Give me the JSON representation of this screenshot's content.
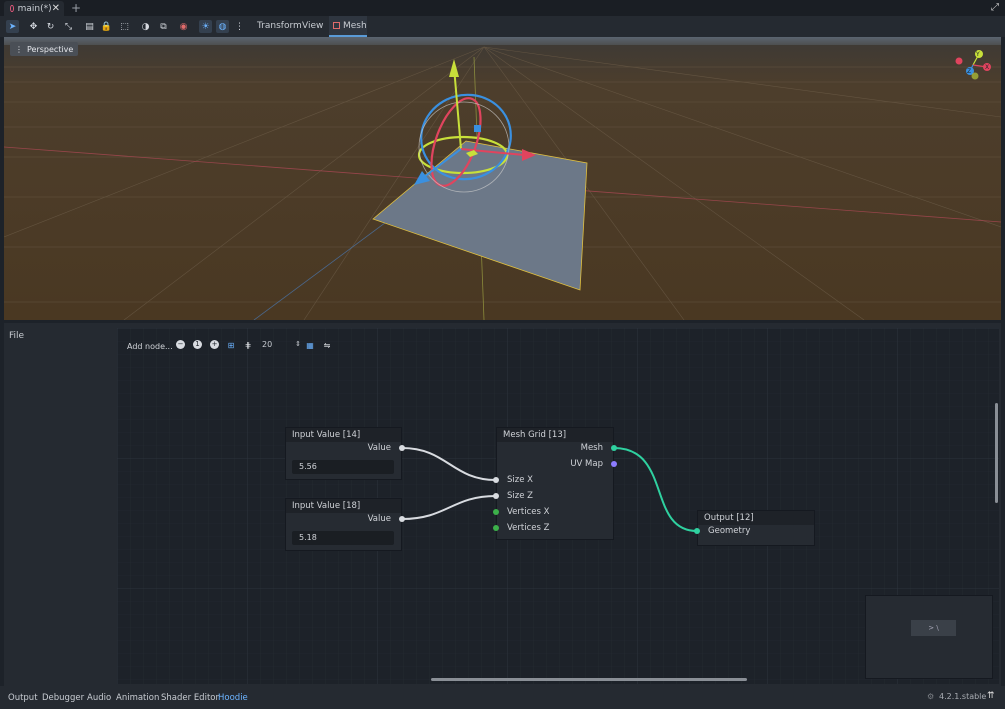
{
  "tab": {
    "title": "main(*)",
    "close": "✕",
    "new": "+"
  },
  "window": {
    "fullscreen": "⤢"
  },
  "toolbar": {
    "icons": [
      {
        "name": "select-tool",
        "glyph": "➤",
        "active": true
      },
      {
        "name": "move-tool",
        "glyph": "✥"
      },
      {
        "name": "rotate-tool",
        "glyph": "↻"
      },
      {
        "name": "scale-tool",
        "glyph": "⤡"
      },
      {
        "name": "list-select-tool",
        "glyph": "▤"
      },
      {
        "name": "lock-tool",
        "glyph": "🔒"
      },
      {
        "name": "group-tool",
        "glyph": "⬚"
      },
      {
        "name": "local-space-tool",
        "glyph": "◑"
      },
      {
        "name": "snap-tool",
        "glyph": "⧉"
      },
      {
        "name": "camera-tool",
        "glyph": "◉"
      },
      {
        "name": "sun-preview-tool",
        "glyph": "☀",
        "active": true
      },
      {
        "name": "environment-preview-tool",
        "glyph": "◍",
        "active": true
      },
      {
        "name": "more-options",
        "glyph": "⋮"
      }
    ],
    "menus": [
      "Transform",
      "View"
    ],
    "mesh_tab": "Mesh"
  },
  "viewport": {
    "mode": "Perspective",
    "axis_labels": {
      "y": "Y",
      "x": "X",
      "z": "Z"
    }
  },
  "panel": {
    "file_menu": "File"
  },
  "graph_toolbar": {
    "add_node": "Add node...",
    "zoom_out": "−",
    "zoom_reset": "1",
    "zoom_in": "+",
    "snap_value": "20"
  },
  "nodes": {
    "input14": {
      "title": "Input Value [14]",
      "output": "Value",
      "value": "5.56"
    },
    "input18": {
      "title": "Input Value [18]",
      "output": "Value",
      "value": "5.18"
    },
    "meshgrid": {
      "title": "Mesh Grid [13]",
      "outputs": [
        "Mesh",
        "UV Map"
      ],
      "inputs": [
        "Size X",
        "Size Z",
        "Vertices X",
        "Vertices Z"
      ]
    },
    "output": {
      "title": "Output [12]",
      "input": "Geometry"
    }
  },
  "bottom_tabs": [
    "Output",
    "Debugger",
    "Audio",
    "Animation",
    "Shader Editor",
    "Hoodie"
  ],
  "active_bottom_tab": "Hoodie",
  "version": "4.2.1.stable",
  "colors": {
    "accent": "#6cb3ff",
    "port_white": "#d8dbe0",
    "port_green": "#2fd18a",
    "port_purple": "#8c7cff",
    "port_green_dark": "#3cb04a"
  }
}
